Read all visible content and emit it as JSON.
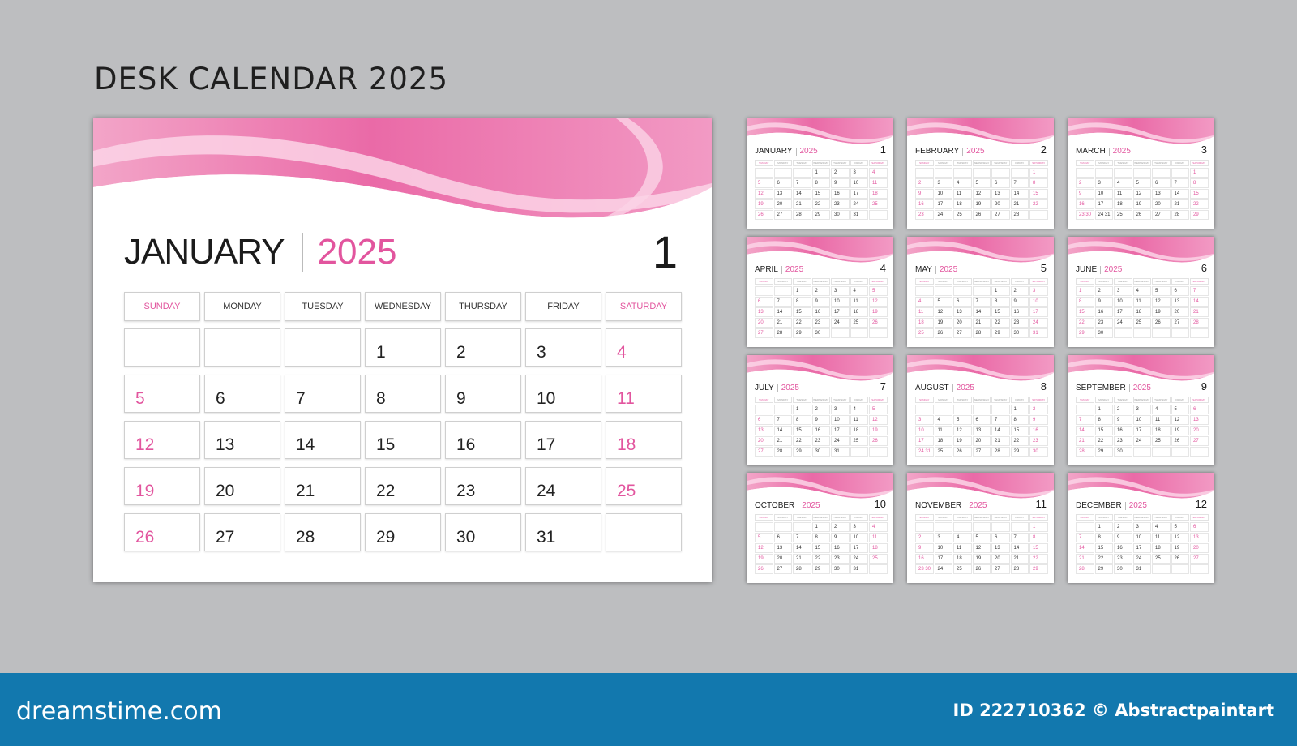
{
  "title": "DESK CALENDAR 2025",
  "accent_color": "#e2559e",
  "year": "2025",
  "weekdays": [
    "SUNDAY",
    "MONDAY",
    "TUESDAY",
    "WEDNESDAY",
    "THURSDAY",
    "FRIDAY",
    "SATURDAY"
  ],
  "main": {
    "month": "JANUARY",
    "year": "2025",
    "number": "1",
    "cells": [
      "",
      "",
      "",
      "1",
      "2",
      "3",
      "4",
      "5",
      "6",
      "7",
      "8",
      "9",
      "10",
      "11",
      "12",
      "13",
      "14",
      "15",
      "16",
      "17",
      "18",
      "19",
      "20",
      "21",
      "22",
      "23",
      "24",
      "25",
      "26",
      "27",
      "28",
      "29",
      "30",
      "31",
      ""
    ]
  },
  "months": [
    {
      "name": "JANUARY",
      "number": "1",
      "start": 3,
      "days": 31,
      "extra": []
    },
    {
      "name": "FEBRUARY",
      "number": "2",
      "start": 6,
      "days": 28,
      "extra": []
    },
    {
      "name": "MARCH",
      "number": "3",
      "start": 6,
      "days": 31,
      "extra": [
        "30",
        "31"
      ]
    },
    {
      "name": "APRIL",
      "number": "4",
      "start": 2,
      "days": 30,
      "extra": []
    },
    {
      "name": "MAY",
      "number": "5",
      "start": 4,
      "days": 31,
      "extra": []
    },
    {
      "name": "JUNE",
      "number": "6",
      "start": 0,
      "days": 30,
      "extra": []
    },
    {
      "name": "JULY",
      "number": "7",
      "start": 2,
      "days": 31,
      "extra": []
    },
    {
      "name": "AUGUST",
      "number": "8",
      "start": 5,
      "days": 31,
      "extra": [
        "31"
      ]
    },
    {
      "name": "SEPTEMBER",
      "number": "9",
      "start": 1,
      "days": 30,
      "extra": []
    },
    {
      "name": "OCTOBER",
      "number": "10",
      "start": 3,
      "days": 31,
      "extra": []
    },
    {
      "name": "NOVEMBER",
      "number": "11",
      "start": 6,
      "days": 30,
      "extra": [
        "30"
      ]
    },
    {
      "name": "DECEMBER",
      "number": "12",
      "start": 1,
      "days": 31,
      "extra": []
    }
  ],
  "footer": {
    "brand": "dreamstime.com",
    "credit": "ID 222710362 © Abstractpaintart"
  }
}
